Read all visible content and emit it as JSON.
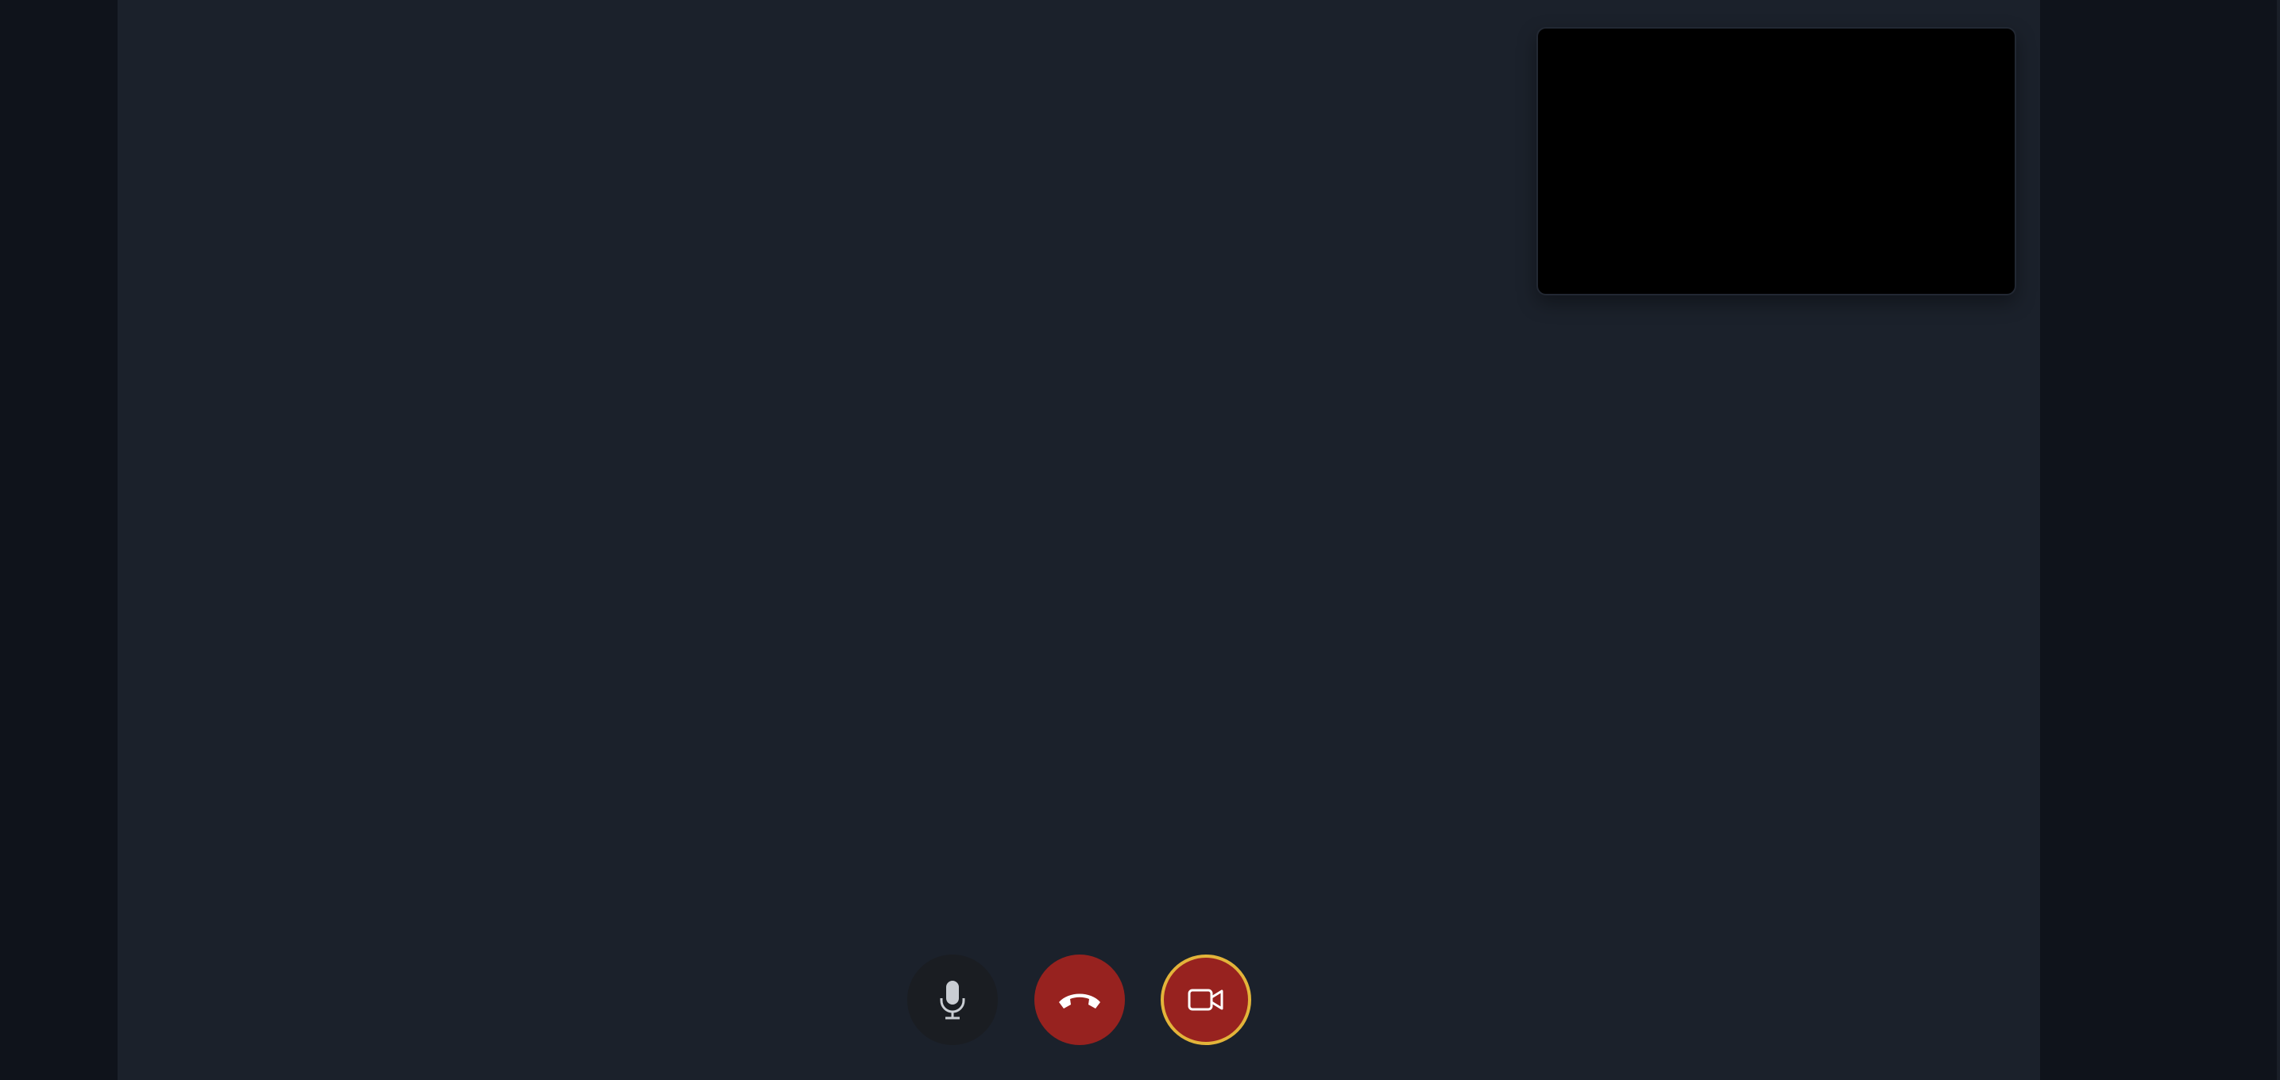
{
  "window": {
    "background": "#0f131b",
    "stage_background": "#1b212b"
  },
  "self_view": {
    "state": "blank",
    "background": "#000000"
  },
  "controls": {
    "mic": {
      "icon": "microphone-icon",
      "state": "on",
      "color": "#1a1d22"
    },
    "hangup": {
      "icon": "phone-hangup-icon",
      "color": "#97221f"
    },
    "camera": {
      "icon": "video-camera-icon",
      "state": "off",
      "color": "#97221f",
      "focus_ring": "#e3b43a"
    }
  }
}
